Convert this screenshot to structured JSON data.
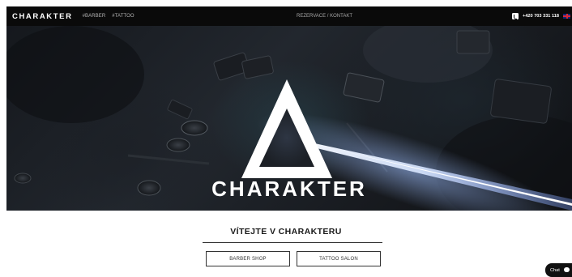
{
  "navbar": {
    "logo": "CHARAKTER",
    "links": [
      "#BARBER",
      "#TATTOO"
    ],
    "center_link": "REZERVACE / KONTAKT",
    "phone": "+420 703 331 118",
    "phone_icon": "phone-icon",
    "language_icon": "uk-flag-icon"
  },
  "hero": {
    "logo_text": "CHARAKTER",
    "logo_mark": "triangle-logo"
  },
  "welcome": {
    "title": "VÍTEJTE V CHARAKTERU",
    "buttons": [
      "BARBER SHOP",
      "TATTOO SALON"
    ]
  },
  "chat": {
    "label": "Chat",
    "icon": "chat-bubble-icon"
  },
  "colors": {
    "navbar_bg": "#0a0a0a",
    "hero_glow": "#a9c4ff",
    "text_dark": "#1a1a1a"
  }
}
